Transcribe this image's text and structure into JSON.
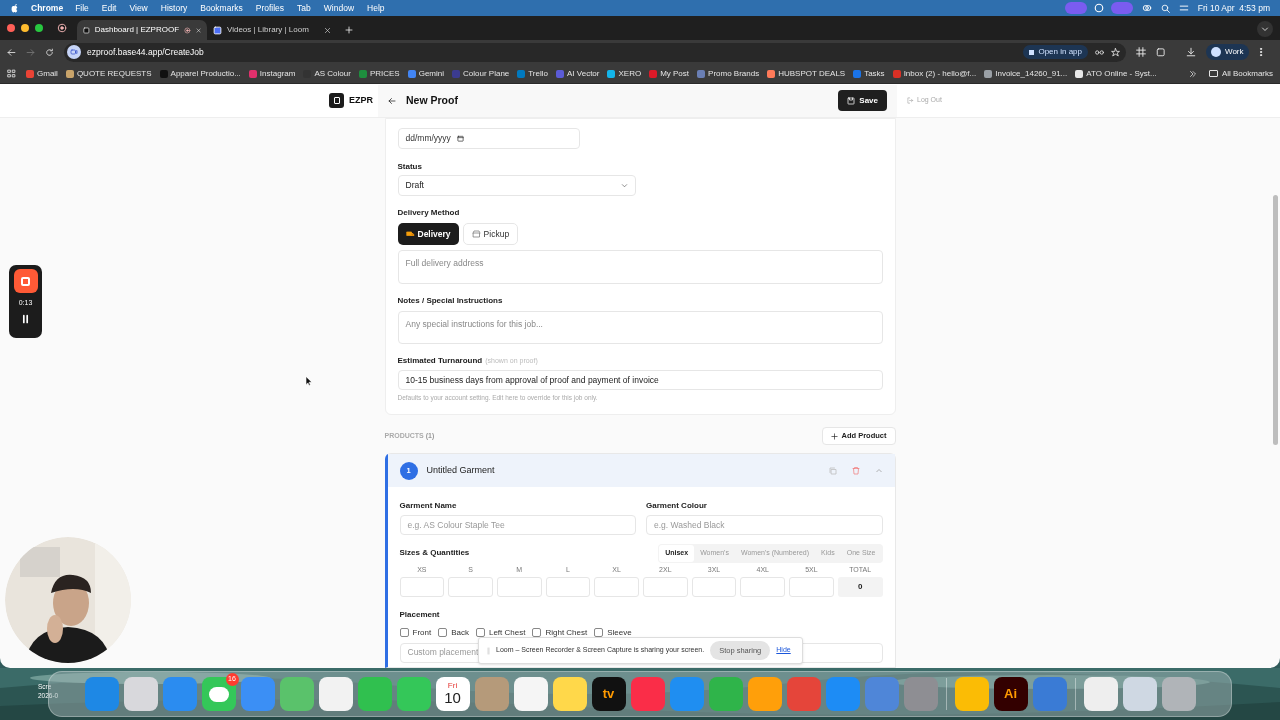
{
  "menubar": {
    "app": "Chrome",
    "menus": [
      "File",
      "Edit",
      "View",
      "History",
      "Bookmarks",
      "Profiles",
      "Tab",
      "Window",
      "Help"
    ],
    "clock": "Fri 10 Apr  4:53 pm"
  },
  "tabs": [
    {
      "title": "Dashboard | EZPROOF",
      "selected": true,
      "recording": true
    },
    {
      "title": "Videos | Library | Loom",
      "selected": false,
      "recording": false
    }
  ],
  "toolbar": {
    "url": "ezproof.base44.app/CreateJob",
    "open_in_app": "Open in app",
    "profile": "Work"
  },
  "bookmarks": {
    "items": [
      {
        "label": "Gmail",
        "color": "#ea4335"
      },
      {
        "label": "QUOTE REQUESTS",
        "color": "#c9a46a"
      },
      {
        "label": "Apparel Productio...",
        "color": "#111111"
      },
      {
        "label": "Instagram",
        "color": "#e1306c"
      },
      {
        "label": "AS Colour",
        "color": "#333333"
      },
      {
        "label": "PRICES",
        "color": "#1e8e3e"
      },
      {
        "label": "Gemini",
        "color": "#4285f4"
      },
      {
        "label": "Colour Plane",
        "color": "#3b3b8f"
      },
      {
        "label": "Trello",
        "color": "#0079bf"
      },
      {
        "label": "AI Vector",
        "color": "#5b5bd6"
      },
      {
        "label": "XERO",
        "color": "#13b5ea"
      },
      {
        "label": "My Post",
        "color": "#dc1928"
      },
      {
        "label": "Promo Brands",
        "color": "#6a7fb5"
      },
      {
        "label": "HUBSPOT DEALS",
        "color": "#ff7a59"
      },
      {
        "label": "Tasks",
        "color": "#1a73e8"
      },
      {
        "label": "Inbox (2) - hello@f...",
        "color": "#d93025"
      },
      {
        "label": "Invoice_14260_91...",
        "color": "#9aa0a6"
      },
      {
        "label": "ATO Online - Syst...",
        "color": "#e8e8e8"
      }
    ],
    "all": "All Bookmarks"
  },
  "app": {
    "brand": "EZPR",
    "page_title": "New Proof",
    "save": "Save",
    "logout": "Log Out"
  },
  "form": {
    "date_placeholder": "dd/mm/yyyy",
    "status": {
      "label": "Status",
      "value": "Draft"
    },
    "delivery": {
      "label": "Delivery Method",
      "options": [
        {
          "label": "Delivery",
          "kind": "truck",
          "selected": true
        },
        {
          "label": "Pickup",
          "kind": "store",
          "selected": false
        }
      ],
      "address_placeholder": "Full delivery address"
    },
    "notes": {
      "label": "Notes / Special Instructions",
      "placeholder": "Any special instructions for this job..."
    },
    "turnaround": {
      "label": "Estimated Turnaround",
      "hint": "(shown on proof)",
      "value": "10-15 business days from approval of proof and payment of invoice",
      "help": "Defaults to your account setting. Edit here to override for this job only."
    }
  },
  "products": {
    "label": "PRODUCTS",
    "count": "(1)",
    "add": "Add Product",
    "items": [
      {
        "number": "1",
        "title": "Untitled Garment",
        "expanded": true,
        "name": {
          "label": "Garment Name",
          "placeholder": "e.g. AS Colour Staple Tee"
        },
        "colour": {
          "label": "Garment Colour",
          "placeholder": "e.g. Washed Black"
        },
        "sizes_label": "Sizes & Quantities",
        "size_sets": [
          {
            "label": "Unisex",
            "selected": true
          },
          {
            "label": "Women's",
            "selected": false
          },
          {
            "label": "Women's (Numbered)",
            "selected": false
          },
          {
            "label": "Kids",
            "selected": false
          },
          {
            "label": "One Size",
            "selected": false
          }
        ],
        "sizes": [
          "XS",
          "S",
          "M",
          "L",
          "XL",
          "2XL",
          "3XL",
          "4XL",
          "5XL"
        ],
        "total_label": "TOTAL",
        "total": "0",
        "placement_label": "Placement",
        "placements": [
          {
            "label": "Front",
            "checked": false
          },
          {
            "label": "Back",
            "checked": false
          },
          {
            "label": "Left Chest",
            "checked": false
          },
          {
            "label": "Right Chest",
            "checked": false
          },
          {
            "label": "Sleeve",
            "checked": false
          }
        ],
        "custom_placeholder": "Custom placement"
      }
    ]
  },
  "loom": {
    "timer": "0:13",
    "banner": "Loom – Screen Recorder & Screen Capture is sharing your screen.",
    "stop": "Stop sharing",
    "hide": "Hide"
  },
  "desktop": {
    "file_lines": [
      "Scre",
      "2026-0"
    ]
  },
  "dock": [
    {
      "kind": "tile",
      "color": "#1e88e5"
    },
    {
      "kind": "tile",
      "color": "#d8d8dc"
    },
    {
      "kind": "tile",
      "color": "#2b8cf0"
    },
    {
      "kind": "badge",
      "color": "#34c759",
      "badge": "16"
    },
    {
      "kind": "tile",
      "color": "#3b8ff5"
    },
    {
      "kind": "tile",
      "color": "#5ac26b"
    },
    {
      "kind": "tile",
      "color": "#f2f2f2"
    },
    {
      "kind": "tile",
      "color": "#30c04f"
    },
    {
      "kind": "tile",
      "color": "#34c759"
    },
    {
      "kind": "calendar",
      "color": "#ffffff",
      "day": "Fri",
      "date": "10"
    },
    {
      "kind": "tile",
      "color": "#b59a7a"
    },
    {
      "kind": "tile",
      "color": "#f5f5f5"
    },
    {
      "kind": "tile",
      "color": "#ffd84a"
    },
    {
      "kind": "text",
      "color": "#111111",
      "text": "tv"
    },
    {
      "kind": "tile",
      "color": "#fa2d48"
    },
    {
      "kind": "tile",
      "color": "#1f8ef1"
    },
    {
      "kind": "tile",
      "color": "#2fb44a"
    },
    {
      "kind": "tile",
      "color": "#ff9f0a"
    },
    {
      "kind": "tile",
      "color": "#e5453a"
    },
    {
      "kind": "tile",
      "color": "#1d8cf5"
    },
    {
      "kind": "tile",
      "color": "#4f86d8"
    },
    {
      "kind": "tile",
      "color": "#8e8e93"
    },
    {
      "kind": "divider"
    },
    {
      "kind": "tile",
      "color": "#fbbc05"
    },
    {
      "kind": "text",
      "color": "#330000",
      "text": "Ai"
    },
    {
      "kind": "tile",
      "color": "#3a7bd5"
    },
    {
      "kind": "divider"
    },
    {
      "kind": "tile",
      "color": "#eeeeee"
    },
    {
      "kind": "tile",
      "color": "#cfd8e3"
    },
    {
      "kind": "tile",
      "color": "#b0b4b8"
    }
  ]
}
